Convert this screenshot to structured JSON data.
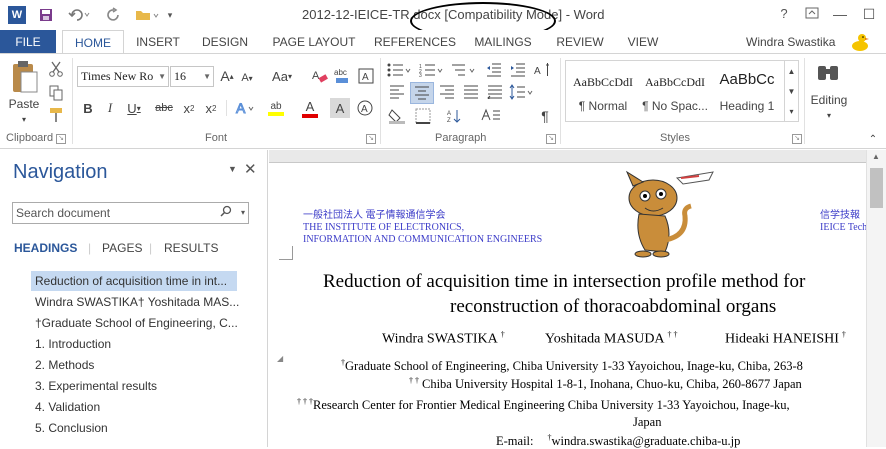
{
  "title_bar": {
    "title": "2012-12-IEICE-TR.docx [Compatibility Mode] - Word",
    "word_icon": "W",
    "icons": [
      "word-app-icon",
      "save-icon",
      "undo-icon",
      "redo-icon",
      "open-icon",
      "customize-icon"
    ]
  },
  "tabs": [
    "FILE",
    "HOME",
    "INSERT",
    "DESIGN",
    "PAGE LAYOUT",
    "REFERENCES",
    "MAILINGS",
    "REVIEW",
    "VIEW"
  ],
  "active_tab": "HOME",
  "user": {
    "name": "Windra Swastika"
  },
  "ribbon": {
    "clipboard": {
      "paste_label": "Paste",
      "group_label": "Clipboard"
    },
    "font": {
      "font_name": "Times New Ro",
      "font_size": "16",
      "group_label": "Font",
      "grow_label": "A",
      "shrink_label": "A",
      "case_label": "Aa",
      "bold": "B",
      "italic": "I",
      "underline": "U",
      "strike": "abc",
      "sub": "x",
      "sup": "x",
      "highlight_label": "ab",
      "color_label": "A",
      "shade_label": "A"
    },
    "paragraph": {
      "group_label": "Paragraph",
      "pilcrow": "¶"
    },
    "styles": {
      "group_label": "Styles",
      "items": [
        {
          "sample": "AaBbCcDdI",
          "name": "¶ Normal"
        },
        {
          "sample": "AaBbCcDdI",
          "name": "¶ No Spac..."
        },
        {
          "sample": "AaBbCc",
          "name": "Heading 1"
        }
      ]
    },
    "editing": {
      "label": "Editing"
    }
  },
  "navigation": {
    "title": "Navigation",
    "search_placeholder": "Search document",
    "tabs": [
      "HEADINGS",
      "PAGES",
      "RESULTS"
    ],
    "active_tab": "HEADINGS",
    "items": [
      "Reduction of acquisition time in int...",
      "Windra SWASTIKA†   Yoshitada MAS...",
      "†Graduate School of Engineering, C...",
      "1. Introduction",
      "2. Methods",
      "3. Experimental results",
      "4. Validation",
      "5. Conclusion"
    ],
    "selected_index": 0
  },
  "document": {
    "header_left_jp": "一般社団法人 電子情報通信学会",
    "header_left_en1": "THE INSTITUTE OF ELECTRONICS,",
    "header_left_en2": "INFORMATION AND COMMUNICATION ENGINEERS",
    "header_right_jp": "信学技報",
    "header_right_en": "IEICE Tech",
    "title_line1": "Reduction of acquisition time in intersection profile method for",
    "title_line2": "reconstruction of thoracoabdominal organs",
    "authors": {
      "a1": "Windra SWASTIKA",
      "a1_mark": "†",
      "a2": "Yoshitada MASUDA",
      "a2_mark": "† †",
      "a3": "Hideaki HANEISHI",
      "a3_mark": "†"
    },
    "affil1_mark": "†",
    "affil1": "Graduate School of Engineering, Chiba University    1-33 Yayoichou, Inage-ku, Chiba, 263-8",
    "affil2_mark": "† †",
    "affil2": "Chiba University Hospital    1-8-1, Inohana, Chuo-ku, Chiba, 260-8677 Japan",
    "affil3_mark": "† † †",
    "affil3": "Research Center for Frontier Medical Engineering Chiba University      1-33 Yayoichou, Inage-ku,",
    "affil3b": "Japan",
    "email_label": "E-mail:",
    "email_mark": "†",
    "email": "windra.swastika@graduate.chiba-u.jp"
  }
}
